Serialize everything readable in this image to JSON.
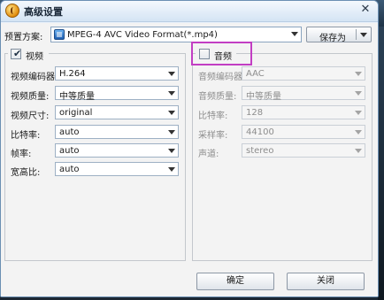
{
  "window": {
    "title": "高级设置",
    "close_glyph": "✕"
  },
  "preset": {
    "label": "预置方案:",
    "value": "MPEG-4 AVC Video Format(*.mp4)",
    "save_as_label": "保存为"
  },
  "video": {
    "enabled": true,
    "title": "视频",
    "check_glyph": "✔",
    "fields": [
      {
        "label": "视频编码器:",
        "value": "H.264"
      },
      {
        "label": "视频质量:",
        "value": "中等质量"
      },
      {
        "label": "视频尺寸:",
        "value": "original"
      },
      {
        "label": "比特率:",
        "value": "auto"
      },
      {
        "label": "帧率:",
        "value": "auto"
      },
      {
        "label": "宽高比:",
        "value": "auto"
      }
    ]
  },
  "audio": {
    "enabled": false,
    "title": "音频",
    "fields": [
      {
        "label": "音频编码器:",
        "value": "AAC"
      },
      {
        "label": "音频质量:",
        "value": "中等质量"
      },
      {
        "label": "比特率:",
        "value": "128"
      },
      {
        "label": "采样率:",
        "value": "44100"
      },
      {
        "label": "声道:",
        "value": "stereo"
      }
    ]
  },
  "buttons": {
    "ok_label": "确定",
    "close_label": "关闭"
  },
  "colors": {
    "highlight": "#c23ec3",
    "disabled_text": "#8d8d8d"
  }
}
